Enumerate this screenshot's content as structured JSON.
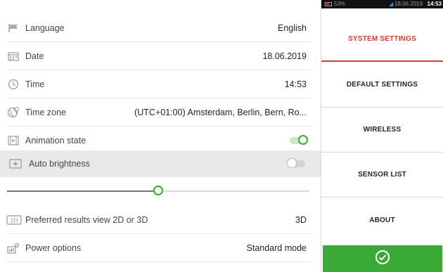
{
  "settings": {
    "rows": [
      {
        "label": "Language",
        "value": "English",
        "icon": "flag-icon"
      },
      {
        "label": "Date",
        "value": "18.06.2019",
        "icon": "calendar-icon"
      },
      {
        "label": "Time",
        "value": "14:53",
        "icon": "clock-icon"
      },
      {
        "label": "Time zone",
        "value": "(UTC+01:00) Amsterdam, Berlin, Bern, Ro...",
        "icon": "globe-icon"
      },
      {
        "label": "Animation state",
        "toggle": true,
        "icon": "animation-icon"
      },
      {
        "label": "Auto brightness",
        "toggle": false,
        "icon": "brightness-icon"
      },
      {
        "label": "Preferred results view 2D or 3D",
        "value": "3D",
        "icon": "view-2d-icon"
      },
      {
        "label": "Power options",
        "value": "Standard mode",
        "icon": "power-options-icon"
      }
    ],
    "brightness_level": 0.5,
    "view_icon_text": "2D"
  },
  "statusbar": {
    "battery": "53%",
    "date": "18.06.2019",
    "time": "14:53"
  },
  "nav": {
    "items": [
      {
        "label": "SYSTEM SETTINGS",
        "active": true
      },
      {
        "label": "DEFAULT SETTINGS",
        "active": false
      },
      {
        "label": "WIRELESS",
        "active": false
      },
      {
        "label": "SENSOR LIST",
        "active": false
      },
      {
        "label": "ABOUT",
        "active": false
      }
    ],
    "confirm_icon": "check-circle-icon"
  },
  "colors": {
    "accent_green": "#3aa935",
    "active_red": "#d93a2f",
    "highlight_row": "#e9e9e9"
  }
}
